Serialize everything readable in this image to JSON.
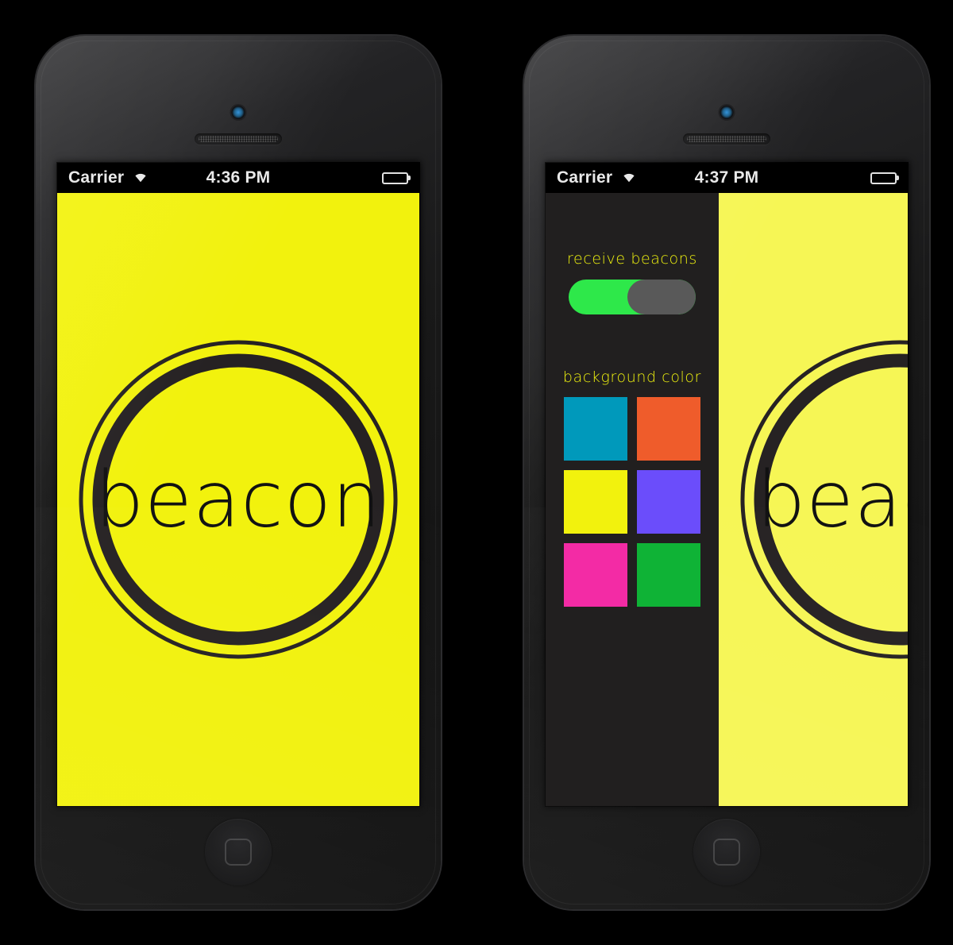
{
  "app": {
    "name": "beacon",
    "logo_text": "beacon"
  },
  "theme": {
    "screen_yellow": "#f2f20d",
    "screen_yellow_lit": "#f6f655",
    "logo_ring": "#262223",
    "drawer_bg": "#211f1f",
    "label_yellow": "#edf00f",
    "toggle_on": "#2ee84a",
    "toggle_knob": "#595959",
    "status_text": "#e9e9e9"
  },
  "phones": [
    {
      "id": "phone-home",
      "status_bar": {
        "carrier": "Carrier",
        "wifi_icon": "wifi-icon",
        "time": "4:36 PM",
        "battery_icon": "battery-icon"
      },
      "drawer_open": false
    },
    {
      "id": "phone-settings",
      "status_bar": {
        "carrier": "Carrier",
        "wifi_icon": "wifi-icon",
        "time": "4:37 PM",
        "battery_icon": "battery-icon"
      },
      "drawer_open": true
    }
  ],
  "settings": {
    "receive_beacons": {
      "label": "receive beacons",
      "state": "on"
    },
    "background_color": {
      "label": "background color",
      "selected": "#f2f20d",
      "swatches": [
        {
          "name": "teal",
          "hex": "#0099bb"
        },
        {
          "name": "orange",
          "hex": "#ef5c2b"
        },
        {
          "name": "yellow",
          "hex": "#f2f20d"
        },
        {
          "name": "purple",
          "hex": "#6b4dfb"
        },
        {
          "name": "magenta",
          "hex": "#f32ba5"
        },
        {
          "name": "green",
          "hex": "#0fb336"
        }
      ]
    }
  },
  "hardware": {
    "camera_icon": "front-camera",
    "speaker_icon": "earpiece-speaker",
    "home_button_icon": "home-button"
  }
}
